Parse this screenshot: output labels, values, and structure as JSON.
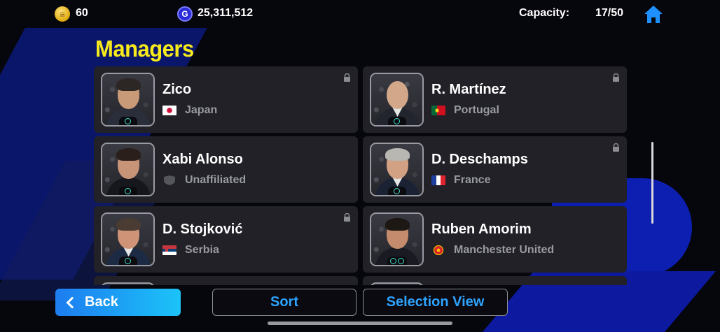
{
  "header": {
    "coins": "60",
    "gp": "25,311,512",
    "capacity_label": "Capacity:",
    "capacity_value": "17/50"
  },
  "title": "Managers",
  "managers": [
    {
      "name": "Zico",
      "nation": "Japan",
      "locked": true
    },
    {
      "name": "R. Martínez",
      "nation": "Portugal",
      "locked": true
    },
    {
      "name": "Xabi Alonso",
      "nation": "Unaffiliated",
      "locked": false
    },
    {
      "name": "D. Deschamps",
      "nation": "France",
      "locked": true
    },
    {
      "name": "D. Stojković",
      "nation": "Serbia",
      "locked": true
    },
    {
      "name": "Ruben Amorim",
      "nation": "Manchester United",
      "locked": false
    }
  ],
  "buttons": {
    "back": "Back",
    "sort": "Sort",
    "selection_view": "Selection View"
  },
  "colors": {
    "title": "#f7ea1c",
    "accent_blue": "#2ea3ff",
    "card_bg": "#212127"
  }
}
